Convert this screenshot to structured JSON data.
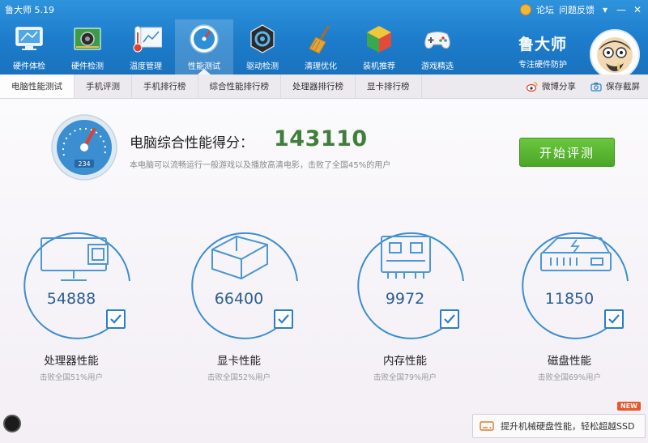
{
  "app": {
    "title": "鲁大师 5.19"
  },
  "top_links": {
    "forum": "论坛",
    "feedback": "问题反馈"
  },
  "nav": [
    {
      "label": "硬件体检"
    },
    {
      "label": "硬件检测"
    },
    {
      "label": "温度管理"
    },
    {
      "label": "性能测试"
    },
    {
      "label": "驱动检测"
    },
    {
      "label": "清理优化"
    },
    {
      "label": "装机推荐"
    },
    {
      "label": "游戏精选"
    }
  ],
  "brand": {
    "name": "鲁大师",
    "tagline": "专注硬件防护"
  },
  "tabs": [
    {
      "label": "电脑性能测试"
    },
    {
      "label": "手机评测"
    },
    {
      "label": "手机排行榜"
    },
    {
      "label": "综合性能排行榜"
    },
    {
      "label": "处理器排行榜"
    },
    {
      "label": "显卡排行榜"
    }
  ],
  "tools": {
    "share": "微博分享",
    "screenshot": "保存截屏"
  },
  "gauge_readout": "234",
  "score": {
    "title": "电脑综合性能得分：",
    "value": "143110",
    "desc": "本电脑可以流畅运行一般游戏以及播放高清电影，击败了全国45%的用户"
  },
  "start_button": "开始评测",
  "cards": [
    {
      "score": "54888",
      "label": "处理器性能",
      "desc": "击败全国51%用户"
    },
    {
      "score": "66400",
      "label": "显卡性能",
      "desc": "击败全国52%用户"
    },
    {
      "score": "9972",
      "label": "内存性能",
      "desc": "击败全国79%用户"
    },
    {
      "score": "11850",
      "label": "磁盘性能",
      "desc": "击败全国69%用户"
    }
  ],
  "promo": {
    "text": "提升机械硬盘性能，轻松超越SSD",
    "badge": "NEW"
  },
  "colors": {
    "topbar": "#1c7ccb",
    "accent_green": "#4aa626",
    "score_green": "#3f7f3a",
    "ring_blue": "#2b7fc6"
  }
}
